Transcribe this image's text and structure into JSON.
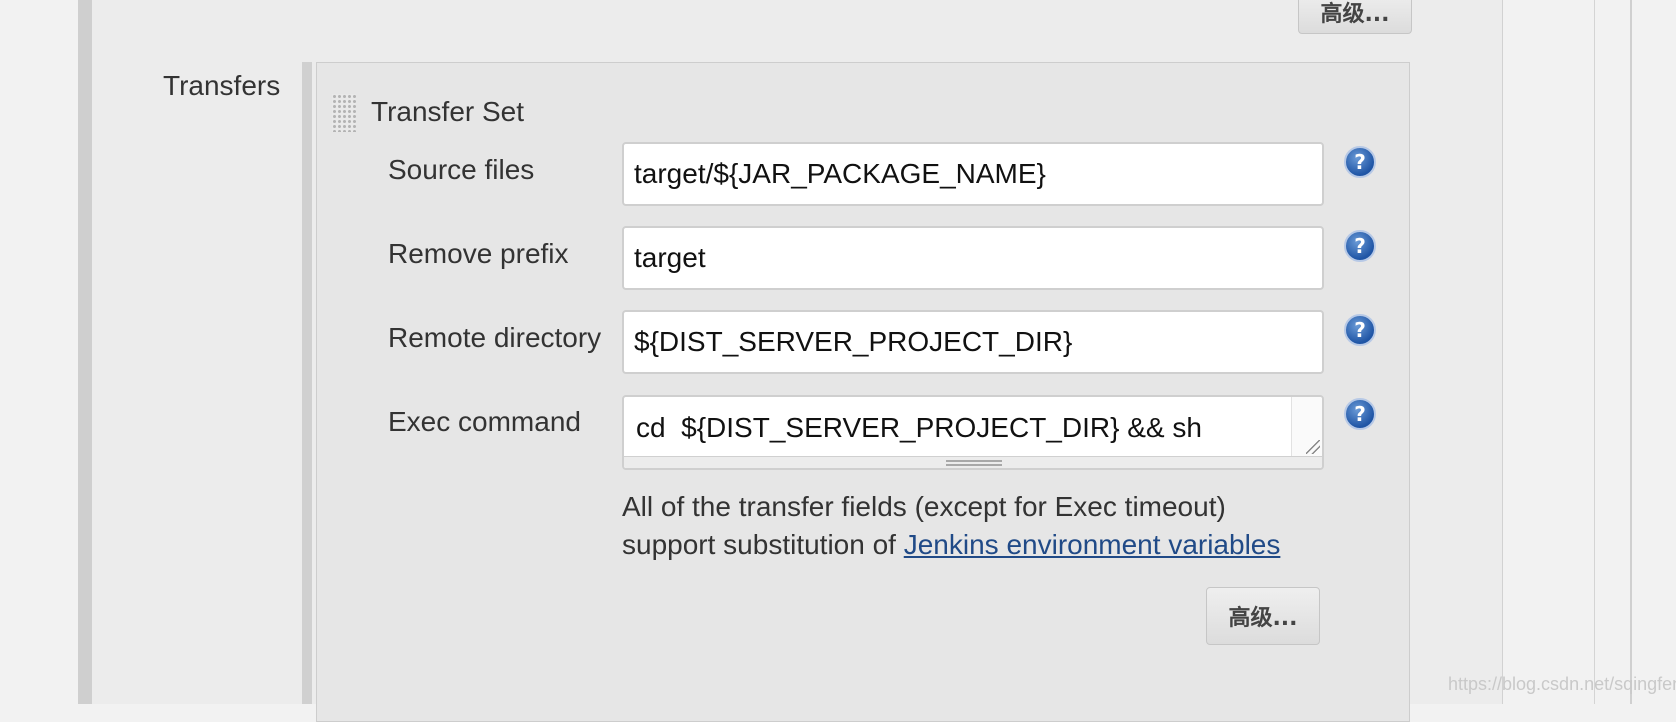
{
  "top_button": {
    "label": "高级..."
  },
  "transfers": {
    "label": "Transfers",
    "set_title": "Transfer Set",
    "fields": {
      "source_files": {
        "label": "Source files",
        "value": "target/${JAR_PACKAGE_NAME}"
      },
      "remove_prefix": {
        "label": "Remove prefix",
        "value": "target"
      },
      "remote_directory": {
        "label": "Remote directory",
        "value": "${DIST_SERVER_PROJECT_DIR}"
      },
      "exec_command": {
        "label": "Exec command",
        "value": "cd  ${DIST_SERVER_PROJECT_DIR} && sh"
      }
    },
    "help_glyph": "?",
    "note": {
      "line1": "All of the transfer fields (except for Exec timeout)",
      "line2_prefix": "support substitution of ",
      "link_text": "Jenkins environment variables"
    },
    "advanced_button": {
      "label": "高级..."
    }
  },
  "icons": {
    "help": "help-icon",
    "drag_handle": "drag-handle-icon",
    "resize": "resize-handle-icon"
  },
  "colors": {
    "link": "#204a87",
    "help_icon": "#1f55a5"
  },
  "watermark": "https://blog.csdn.net/sqingfeng"
}
